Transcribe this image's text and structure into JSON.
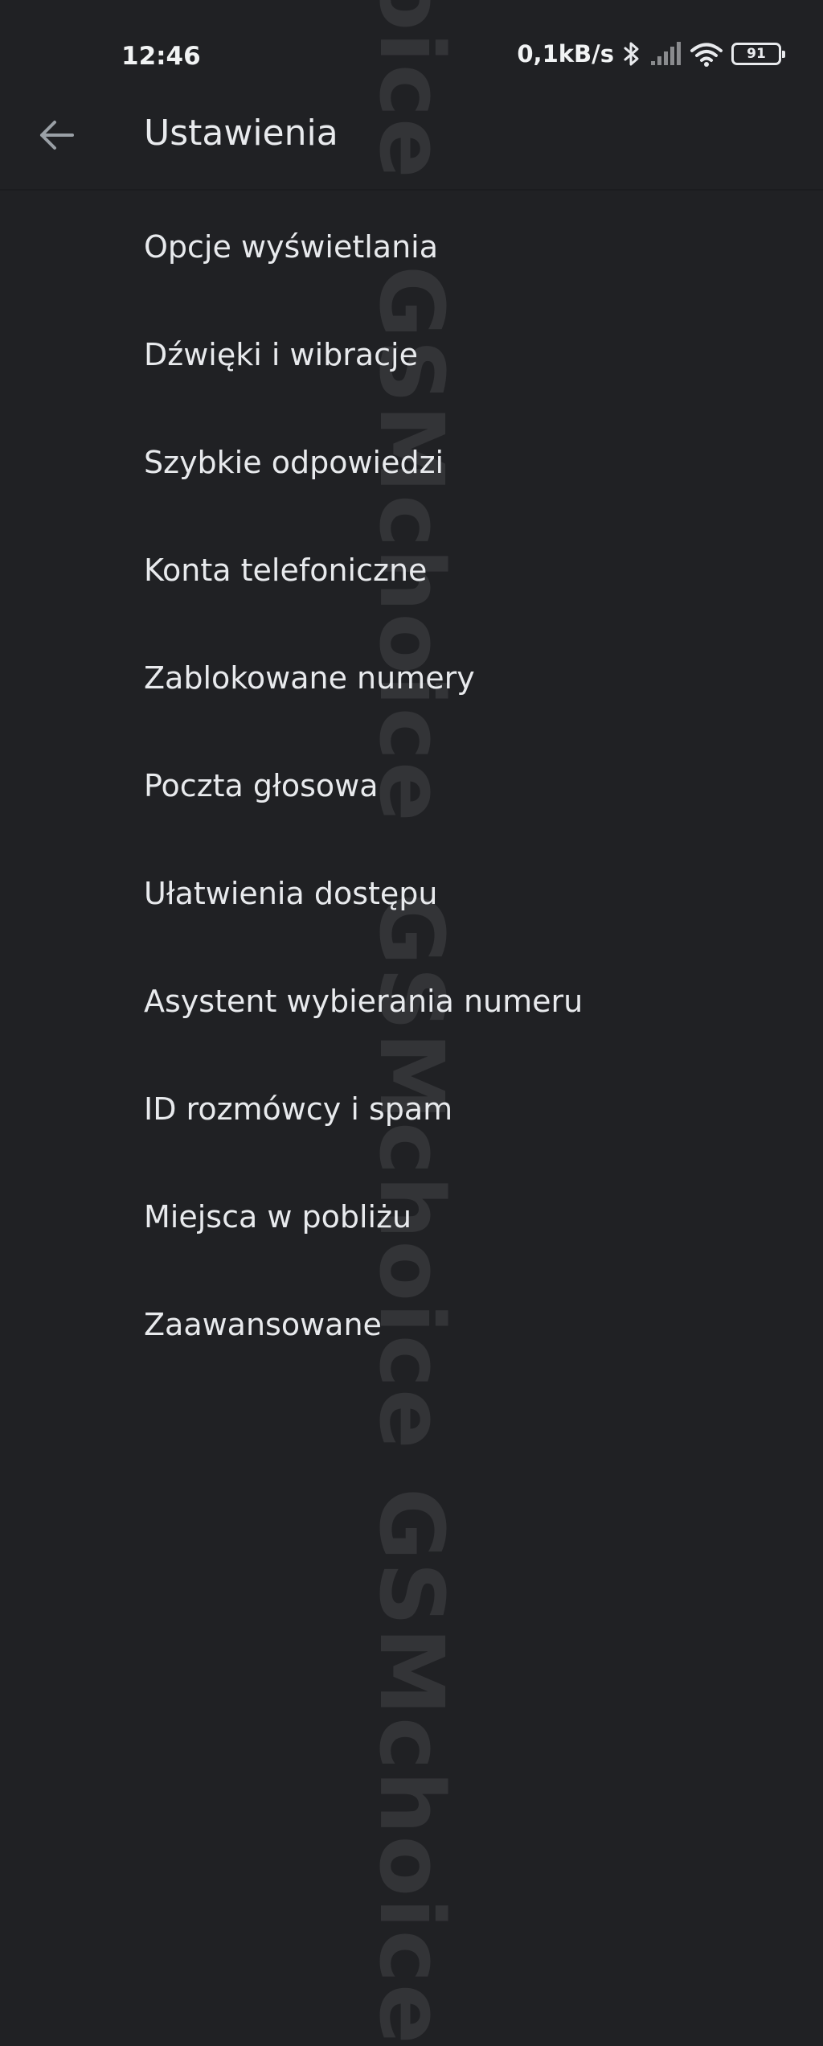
{
  "status_bar": {
    "time": "12:46",
    "net_speed": "0,1kB/s",
    "battery_level": "91",
    "icons": [
      "bluetooth-icon",
      "cellular-signal-icon",
      "wifi-icon",
      "battery-icon"
    ]
  },
  "app_bar": {
    "title": "Ustawienia",
    "back_icon": "arrow-back-icon"
  },
  "settings_items": [
    "Opcje wyświetlania",
    "Dźwięki i wibracje",
    "Szybkie odpowiedzi",
    "Konta telefoniczne",
    "Zablokowane numery",
    "Poczta głosowa",
    "Ułatwienia dostępu",
    "Asystent wybierania numeru",
    "ID rozmówcy i spam",
    "Miejsca w pobliżu",
    "Zaawansowane"
  ],
  "watermarks": [
    "GSMchoice",
    "GSMchoice",
    "GSMchoice",
    "GSMchoice"
  ],
  "colors": {
    "background": "#202124",
    "text": "#e8eaed",
    "watermark": "#333437"
  }
}
